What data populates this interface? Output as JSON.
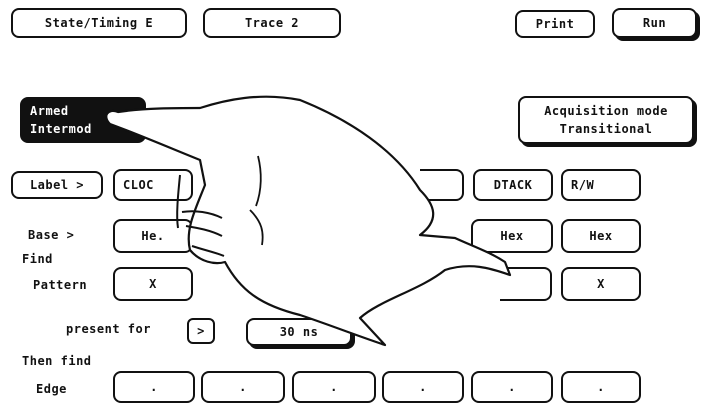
{
  "header": {
    "mode_button": "State/Timing E",
    "trace_button": "Trace 2",
    "print_button": "Print",
    "run_button": "Run"
  },
  "armed": {
    "line1": "Armed",
    "line2": "Intermod"
  },
  "acquisition": {
    "line1": "Acquisition mode",
    "line2": "Transitional"
  },
  "label_row": {
    "label_button": "Label >",
    "fields": [
      "CLOC",
      "DTACK",
      "R/W"
    ]
  },
  "base_row": {
    "label": "Base >",
    "fields": [
      "He.",
      "Hex",
      "Hex"
    ]
  },
  "find": {
    "label": "Find"
  },
  "pattern_row": {
    "label": "Pattern",
    "fields": [
      "X",
      "X"
    ]
  },
  "present": {
    "label": "present for",
    "arrow": ">",
    "duration": "30 ns"
  },
  "then_find": {
    "label": "Then find"
  },
  "edge_row": {
    "label": "Edge",
    "fields": [
      ".",
      ".",
      ".",
      ".",
      ".",
      "."
    ]
  }
}
